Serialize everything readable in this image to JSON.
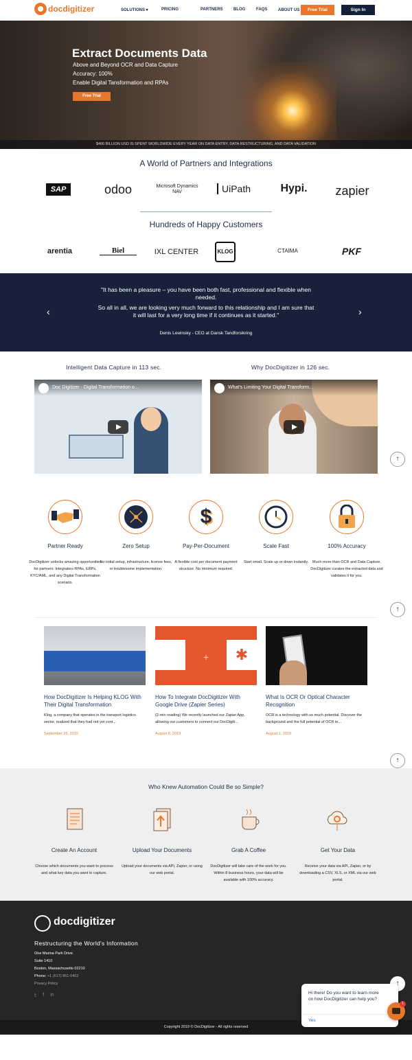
{
  "nav": {
    "logo": "docdigitizer",
    "items": [
      "SOLUTIONS",
      "PRICING",
      "PARTNERS",
      "BLOG",
      "FAQS",
      "ABOUT US"
    ],
    "free_trial": "Free Trial",
    "sign_in": "Sign In"
  },
  "hero": {
    "title": "Extract Documents Data",
    "lines": [
      "Above and Beyond OCR and Data Capture",
      "Accuracy: 100%",
      "Enable Digital Tansformation and RPAs"
    ],
    "button": "Free Trial",
    "band": "$400 BILLION USD IS SPENT WORLDWIDE EVERY YEAR ON DATA ENTRY, DATA RESTRUCTURING, AND DATA VALIDATION"
  },
  "partners": {
    "title": "A World of Partners and Integrations",
    "logos": [
      "SAP",
      "odoo",
      "Microsoft Dynamics NAV",
      "UiPath",
      "Hypi.",
      "zapier"
    ]
  },
  "customers": {
    "title": "Hundreds of Happy Customers",
    "logos": [
      "arentia",
      "Biel",
      "IXL CENTER",
      "KLOG",
      "CTAIMA",
      "PKF"
    ]
  },
  "testimonial": {
    "line1": "\"It has been a pleasure – you have been both fast, professional and flexible when needed.",
    "line2": "So all in all, we are looking very much forward to this relationship and I am sure that it will last for a very long time if it continues as it started.\"",
    "author": "Denis Lewinsky - CEO at Dansk Tandforsikring"
  },
  "videos": [
    {
      "heading": "Intelligent Data Capture in 113 sec.",
      "title": "Doc Digitizer - Digital Transformation o..."
    },
    {
      "heading": "Why DocDigitizer in 126 sec.",
      "title": "What's Limiting Your Digital Transform..."
    }
  ],
  "features": [
    {
      "title": "Partner Ready",
      "text": "DocDigitizer unlocks amazing opportunities for partners: Integrators RPAs, ERPs, KYC/AML, and any Digital Transformation scenario."
    },
    {
      "title": "Zero Setup",
      "text": "No initial setup, infrastructure, license fees, or troublesome implementation."
    },
    {
      "title": "Pay-Per-Document",
      "text": "A flexible cost per document payment structure. No minimum required."
    },
    {
      "title": "Scale Fast",
      "text": "Start small. Scale up or down instantly."
    },
    {
      "title": "100% Accuracy",
      "text": "Much more than OCR and Data Capture. DocDigitizer curates the extracted data and validates it for you."
    }
  ],
  "blog": [
    {
      "title": "How DocDigitizer Is Helping KLOG With Their Digital Transformation",
      "text": "Klog, a company that operates in the transport logistics sector, realized that they had not yet cont...",
      "date": "September 26, 2019"
    },
    {
      "title": "How To Integrate DocDigitizer With Google Drive (Zapier Series)",
      "text": "(2-min reading) We recently launched our Zapier App, allowing our customers to connect our DocDigiti...",
      "date": "August 8, 2019"
    },
    {
      "title": "What Is OCR Or Optical Character Recognition",
      "text": "OCR is a technology with so much potential. Discover the background and the full potential of OCR te...",
      "date": "August 1, 2019"
    }
  ],
  "steps": {
    "title": "Who Knew Automation Could Be so Simple?",
    "items": [
      {
        "title": "Create An Account",
        "text": "Choose which documents you want to process and what key data you want to capture."
      },
      {
        "title": "Upload Your Documents",
        "text": "Upload your documents via API, Zapier, or using our web portal."
      },
      {
        "title": "Grab A Coffee",
        "text": "DocDigitizer will take care of the work for you. Within 8 business hours, your data will be available with 100% accuracy."
      },
      {
        "title": "Get Your Data",
        "text": "Receive your data via API, Zapier, or by downloading a CSV, XLS, or XML via our web portal."
      }
    ]
  },
  "footer": {
    "logo": "docdigitizer",
    "tagline": "Restructuring the World's Information",
    "address": [
      "One Marina Park Drive",
      "Suite 1410",
      "Boston, Massachusetts 02210"
    ],
    "phone_label": "Phone:",
    "phone": "+1 (617) 861-0402",
    "privacy": "Privacy Policy",
    "social": [
      "twitter-icon",
      "facebook-icon",
      "linkedin-icon"
    ],
    "copyright": "Copyright 2019 © DocDigitizer - All rights reserved"
  },
  "chat": {
    "message": "Hi there! Do you want to learn more on how DocDigitizer can help you?",
    "reply": "Yes",
    "badge": "1"
  },
  "colors": {
    "accent": "#e8772e",
    "navy": "#17223a"
  }
}
